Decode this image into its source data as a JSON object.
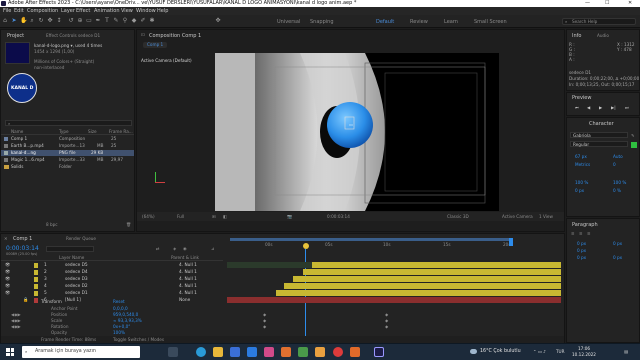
{
  "titlebar": {
    "text": "Adobe After Effects 2023 - C:\\Users\\ayane\\OneDriv... ve\\YUSUF DERSLERİ\\YUSUFALAR\\KANAL D LOGO ANİMASYONI\\kanal d logo anim.aep *",
    "min": "—",
    "max": "☐",
    "close": "✕"
  },
  "menu": [
    "File",
    "Edit",
    "Composition",
    "Layer",
    "Effect",
    "Animation",
    "View",
    "Window",
    "Help"
  ],
  "workspaces": {
    "default": "Default",
    "review": "Review",
    "learn": "Learn",
    "small_screen": "Small Screen",
    "search": "Search Help"
  },
  "toolbar_labels": {
    "universal": "Universal",
    "snapping": "Snapping"
  },
  "project": {
    "tab": "Project",
    "effects_tab": "Effect Controls sedece D1",
    "selected_name": "kanal-d-logo.png ▾, used 4 times",
    "selected_dims": "1454 x 1294 (1,00)",
    "selected_info1": "Millions of Colors+ (Straight)",
    "selected_info2": "non-interlaced",
    "logo_text": "KANAL D",
    "search_placeholder": "ρ",
    "cols": {
      "name": "Name",
      "type": "Type",
      "size": "Size",
      "frame": "Frame Ra..."
    },
    "items": [
      {
        "name": "Comp 1",
        "type": "Composition",
        "size": "",
        "frame": "25"
      },
      {
        "name": "Earth B...p.mp4",
        "type": "Importe...13",
        "size": "MB",
        "frame": "25"
      },
      {
        "name": "kanal-d...ng",
        "type": "PNG file",
        "size": "29 KB",
        "frame": ""
      },
      {
        "name": "Magic 1...6.mp4",
        "type": "Importe...33",
        "size": "MB",
        "frame": "29,97"
      },
      {
        "name": "Solids",
        "type": "Folder",
        "size": "",
        "frame": ""
      }
    ],
    "bpc": "8 bpc"
  },
  "comp": {
    "tab": "Composition Comp 1",
    "sub_tab": "Comp 1",
    "camera_label": "Active Camera (Default)",
    "zoom": "(64%)",
    "res": "Full",
    "timecode": "0:00:03:14",
    "renderer": "Classic 3D",
    "camera": "Active Camera",
    "views": "1 View"
  },
  "right": {
    "info_tab": "Info",
    "audio_tab": "Audio",
    "info_rgb": [
      "R :",
      "G :",
      "B :",
      "A :"
    ],
    "info_xy": [
      "X : 1312",
      "Y : 478"
    ],
    "info_layer": "sedece D1",
    "info_dur": "Duration: 0;00;22;00, ∆ +0;00;00",
    "info_in": "In: 0;00;13;25, Out: 0;00;15;17",
    "preview_tab": "Preview",
    "char_tab": "Character",
    "font": "Gabriola",
    "style": "Regular",
    "size": "67 px",
    "leading": "Auto",
    "tracking": "0",
    "kern": "Metrics",
    "percent_v": "100 %",
    "percent_h": "100 %",
    "baseline": "0 px",
    "tsume": "0 %",
    "para_tab": "Paragraph",
    "para_vals": [
      "0 px",
      "0 px",
      "0 px",
      "0 px",
      "0 px"
    ]
  },
  "timeline": {
    "tab": "Comp 1",
    "render_tab": "Render Queue",
    "timecode": "0:00:03:14",
    "fps": "00089 (25.00 fps)",
    "cols": {
      "source": "Layer Name",
      "parent": "Parent & Link"
    },
    "ticks": [
      "00s",
      "05s",
      "10s",
      "15s",
      "20s"
    ],
    "layers": [
      {
        "num": "1",
        "name": "sedece D5",
        "parent": "4. Null 1",
        "color": "#c8b832"
      },
      {
        "num": "2",
        "name": "sedece D4",
        "parent": "4. Null 1",
        "color": "#c8b832"
      },
      {
        "num": "3",
        "name": "sedece D3",
        "parent": "4. Null 1",
        "color": "#c8b832"
      },
      {
        "num": "4",
        "name": "sedece D2",
        "parent": "4. Null 1",
        "color": "#c8b832"
      },
      {
        "num": "5",
        "name": "sedece D1",
        "parent": "4. Null 1",
        "color": "#c8b832"
      },
      {
        "num": "6",
        "name": "[Null 1]",
        "parent": "None",
        "color": "#b03a3a"
      }
    ],
    "transform": {
      "label": "Transform",
      "reset": "Reset",
      "props": [
        {
          "name": "Anchor Point",
          "value": "0,0,0,0"
        },
        {
          "name": "Position",
          "value": "959,0,540,0"
        },
        {
          "name": "Scale",
          "value": "∞ 93,3,93,3%"
        },
        {
          "name": "Rotation",
          "value": "0x+0,0°"
        },
        {
          "name": "Opacity",
          "value": "100%"
        }
      ]
    },
    "footer": {
      "render_time": "Frame Render Time: 88ms",
      "toggle": "Toggle Switches / Modes"
    }
  },
  "taskbar": {
    "search": "Aramak için buraya yazın",
    "weather": "16°C  Çok bulutlu",
    "time": "17:06",
    "date": "10.12.2022",
    "lang": "TUR"
  }
}
